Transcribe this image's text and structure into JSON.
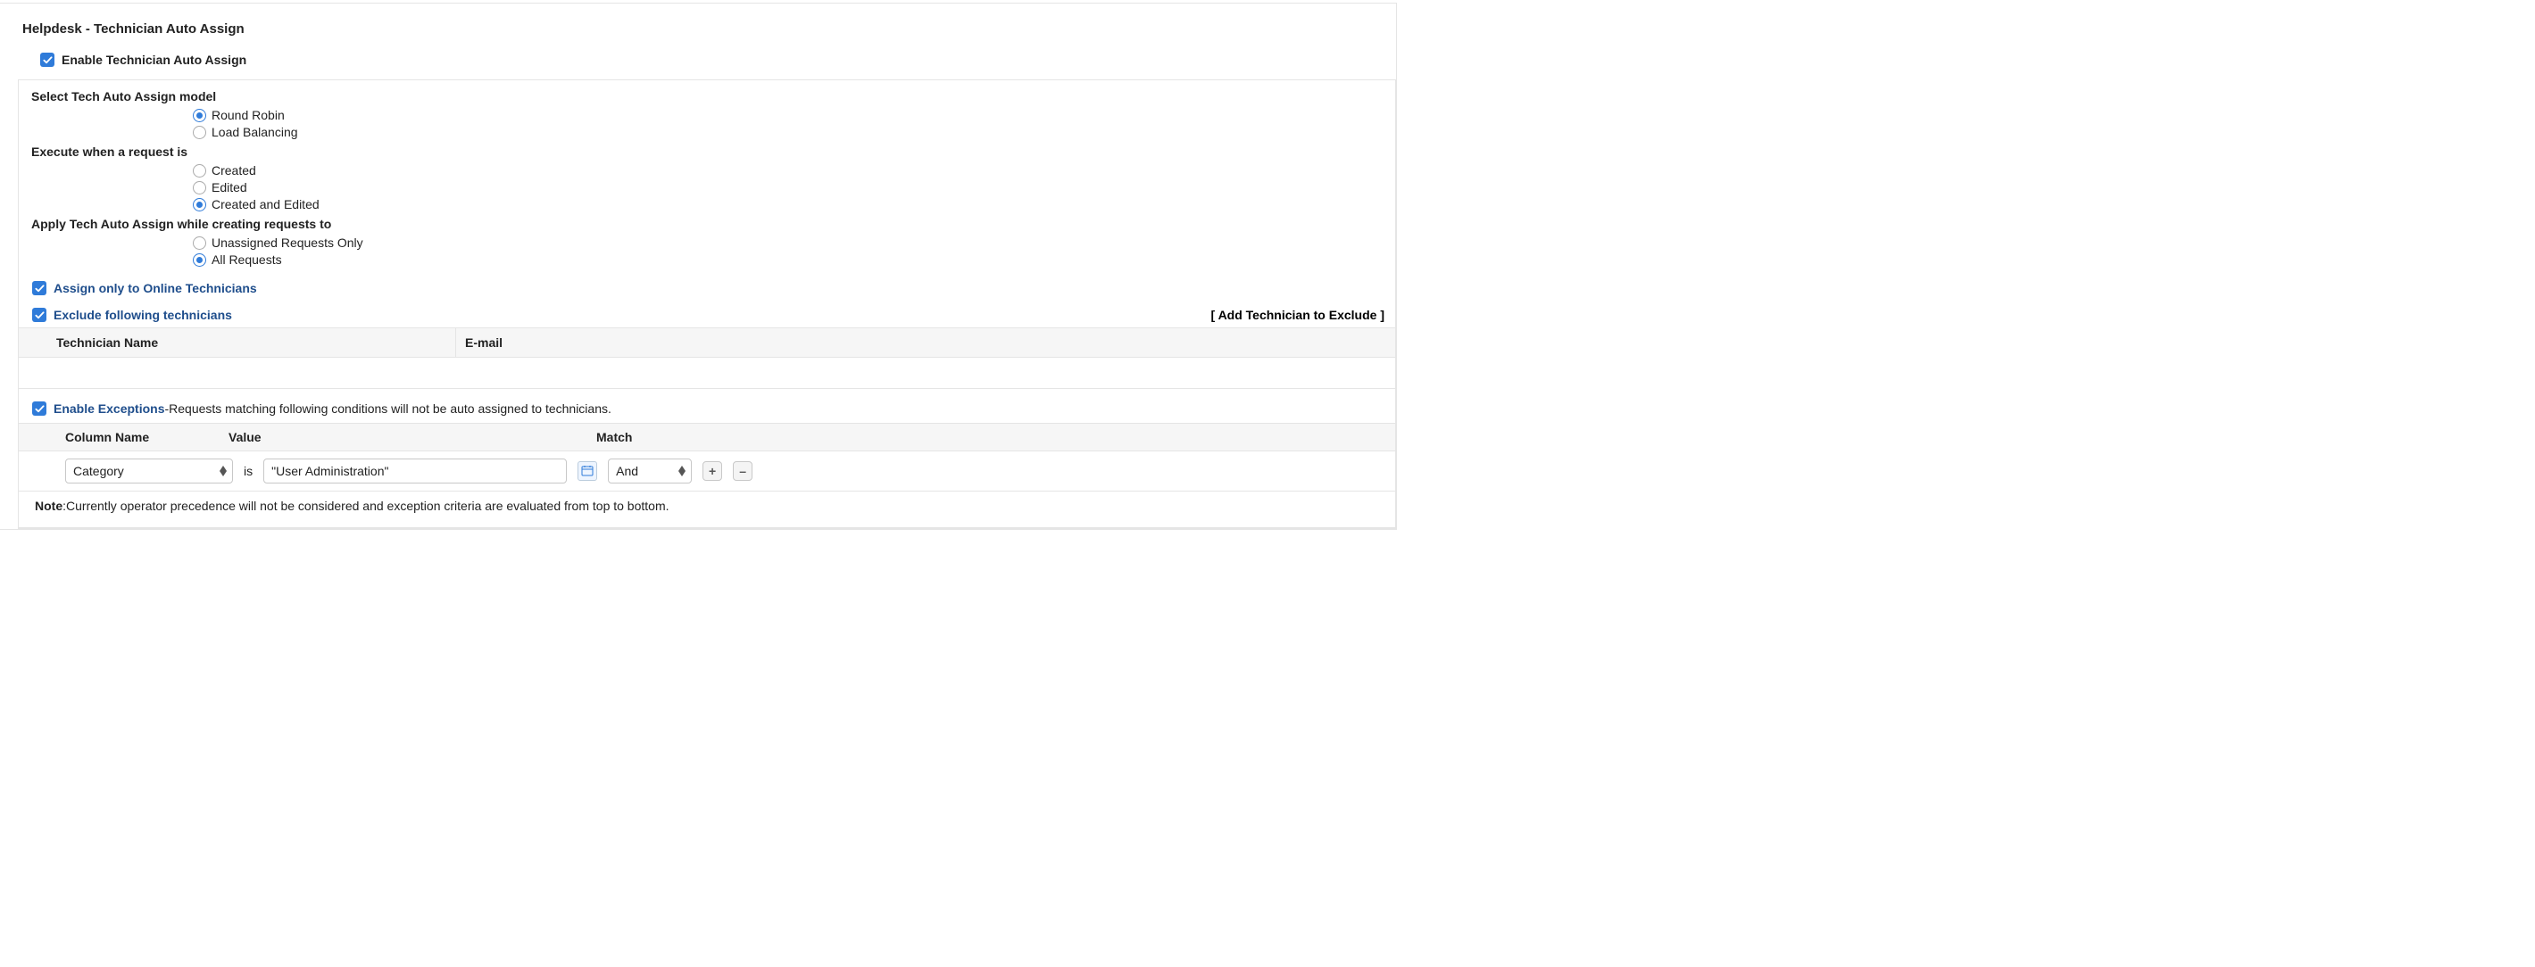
{
  "title": "Helpdesk - Technician Auto Assign",
  "enable_label": "Enable Technician Auto Assign",
  "model": {
    "label": "Select Tech Auto Assign model",
    "options": [
      "Round Robin",
      "Load Balancing"
    ],
    "selected": 0
  },
  "execute": {
    "label": "Execute when a request is",
    "options": [
      "Created",
      "Edited",
      "Created and Edited"
    ],
    "selected": 2
  },
  "apply_scope": {
    "label": "Apply Tech Auto Assign while creating requests to",
    "options": [
      "Unassigned Requests Only",
      "All Requests"
    ],
    "selected": 1
  },
  "online_only_label": "Assign only to Online Technicians",
  "exclude_label": "Exclude following technicians",
  "add_exclude_link": "[  Add Technician to Exclude  ]",
  "tech_table": {
    "columns": [
      "Technician Name",
      "E-mail"
    ]
  },
  "exceptions": {
    "label": "Enable Exceptions",
    "desc": "-Requests matching following conditions will not be auto assigned to technicians.",
    "columns": [
      "Column Name",
      "Value",
      "Match"
    ],
    "rule": {
      "column": "Category",
      "is_label": "is",
      "value": "\"User Administration\"",
      "match": "And"
    },
    "note_label": "Note",
    "note_text": ":Currently operator precedence will not be considered and exception criteria are evaluated from top to bottom."
  },
  "icons": {
    "plus": "+",
    "minus": "–"
  }
}
